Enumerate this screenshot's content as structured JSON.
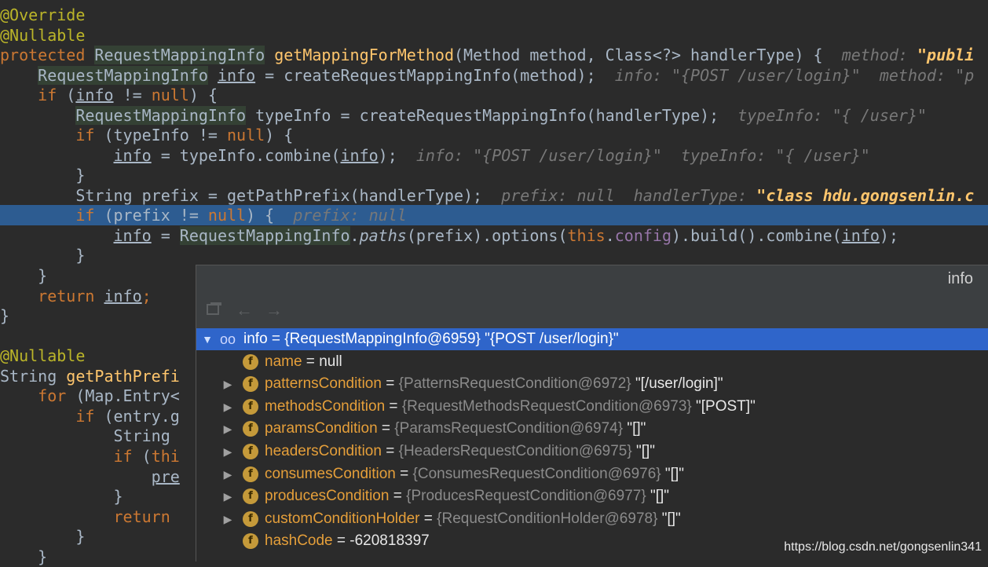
{
  "editor": {
    "l1": "@Override",
    "l2": "@Nullable",
    "l3a": "protected ",
    "l3b": "RequestMappingInfo",
    "l3c": " ",
    "l3d": "getMappingForMethod",
    "l3e": "(Method method, Class<?> handlerType) {  ",
    "l3f": "method: ",
    "l3g": "\"publi",
    "l4a": "    ",
    "l4b": "RequestMappingInfo",
    "l4c": " ",
    "l4d": "info",
    "l4e": " = createRequestMappingInfo(method);  ",
    "l4f": "info: \"{POST /user/login}\"  method: \"p",
    "l5a": "    ",
    "l5b": "if",
    "l5c": " (",
    "l5d": "info",
    "l5e": " != ",
    "l5f": "null",
    "l5g": ") {",
    "l6a": "        ",
    "l6b": "RequestMappingInfo",
    "l6c": " typeInfo = createRequestMappingInfo(handlerType);  ",
    "l6d": "typeInfo: \"{ /user}\"",
    "l7a": "        ",
    "l7b": "if",
    "l7c": " (typeInfo != ",
    "l7d": "null",
    "l7e": ") {",
    "l8a": "            ",
    "l8b": "info",
    "l8c": " = typeInfo.combine(",
    "l8d": "info",
    "l8e": ");  ",
    "l8f": "info: \"{POST /user/login}\"  typeInfo: \"{ /user}\"",
    "l9": "        }",
    "l10a": "        String prefix = getPathPrefix(handlerType);  ",
    "l10b": "prefix: null  handlerType: ",
    "l10c": "\"class hdu.gongsenlin.c",
    "l11a": "        ",
    "l11b": "if",
    "l11c": " (prefix != ",
    "l11d": "null",
    "l11e": ") {  ",
    "l11f": "prefix: null",
    "l12a": "            ",
    "l12b": "info",
    "l12c": " = ",
    "l12d": "RequestMappingInfo",
    "l12e": ".",
    "l12f": "paths",
    "l12g": "(prefix).options(",
    "l12h": "this",
    "l12i": ".",
    "l12j": "config",
    "l12k": ").build().combine(",
    "l12l": "info",
    "l12m": ");",
    "l13": "        }",
    "l14": "    }",
    "l15a": "    ",
    "l15b": "return",
    "l15c": " ",
    "l15d": "info",
    "l15e": ";",
    "l16": "}",
    "l18": "@Nullable",
    "l19a": "String ",
    "l19b": "getPathPrefi",
    "l20a": "    ",
    "l20b": "for",
    "l20c": " (Map.Entry<",
    "l21a": "        ",
    "l21b": "if",
    "l21c": " (entry.g",
    "l22": "            String ",
    "l23a": "            ",
    "l23b": "if",
    "l23c": " (",
    "l23d": "thi",
    "l24a": "                ",
    "l24b": "pre",
    "l25": "            }",
    "l26a": "            ",
    "l26b": "return",
    "l27": "        }",
    "l28": "    }"
  },
  "popup": {
    "title": "info",
    "toolbar": {
      "icons": [
        "frames-icon",
        "back-arrow-icon",
        "forward-arrow-icon"
      ]
    },
    "root": {
      "name": "info",
      "eq": " = ",
      "ref": "{RequestMappingInfo@6959}",
      "value": " \"{POST /user/login}\""
    },
    "fields": [
      {
        "name": "name",
        "ref": "",
        "value": "null"
      },
      {
        "name": "patternsCondition",
        "ref": "{PatternsRequestCondition@6972}",
        "value": "\"[/user/login]\""
      },
      {
        "name": "methodsCondition",
        "ref": "{RequestMethodsRequestCondition@6973}",
        "value": "\"[POST]\""
      },
      {
        "name": "paramsCondition",
        "ref": "{ParamsRequestCondition@6974}",
        "value": "\"[]\""
      },
      {
        "name": "headersCondition",
        "ref": "{HeadersRequestCondition@6975}",
        "value": "\"[]\""
      },
      {
        "name": "consumesCondition",
        "ref": "{ConsumesRequestCondition@6976}",
        "value": "\"[]\""
      },
      {
        "name": "producesCondition",
        "ref": "{ProducesRequestCondition@6977}",
        "value": "\"[]\""
      },
      {
        "name": "customConditionHolder",
        "ref": "{RequestConditionHolder@6978}",
        "value": "\"[]\""
      },
      {
        "name": "hashCode",
        "ref": "",
        "value": "-620818397"
      }
    ],
    "eq": " = ",
    "badge": "f"
  },
  "watermark": "https://blog.csdn.net/gongsenlin341",
  "colors": {
    "background": "#2b2b2b",
    "selection": "#2f65ca",
    "highlight_line": "#2d5c91",
    "keyword": "#cc7832",
    "annotation": "#bbb529",
    "function": "#ffc66d"
  }
}
